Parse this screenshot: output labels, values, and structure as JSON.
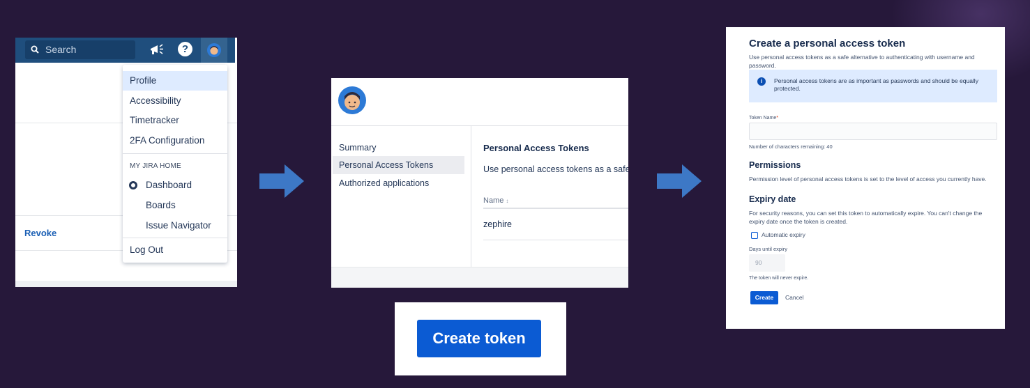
{
  "colors": {
    "background": "#26183a",
    "jira_header": "#1f4e7d",
    "primary_button": "#0b5bd3",
    "arrow": "#3d78c6"
  },
  "panel1": {
    "search": {
      "placeholder": "Search",
      "icon": "search-icon"
    },
    "header_icons": [
      "megaphone-icon",
      "help-icon",
      "avatar"
    ],
    "revoke_label": "Revoke",
    "menu": {
      "items_top": [
        "Profile",
        "Accessibility",
        "Timetracker",
        "2FA Configuration"
      ],
      "section_heading": "MY JIRA HOME",
      "home_options": [
        "Dashboard",
        "Boards",
        "Issue Navigator"
      ],
      "selected_home": "Dashboard",
      "logout": "Log Out"
    }
  },
  "panel2": {
    "nav": [
      "Summary",
      "Personal Access Tokens",
      "Authorized applications"
    ],
    "active_nav": "Personal Access Tokens",
    "section_title": "Personal Access Tokens",
    "description": "Use personal access tokens as a safe al",
    "table": {
      "header": "Name",
      "sort_indicator": "↕",
      "rows": [
        "zephire"
      ]
    }
  },
  "create_token_label": "Create token",
  "panel3": {
    "title": "Create a personal access token",
    "intro_line1": "Use personal access tokens as a safe alternative to authenticating with username and",
    "intro_line2": "password.",
    "info_message": "Personal access tokens are as important as passwords and should be equally protected.",
    "token_name_label": "Token Name",
    "required_marker": "*",
    "chars_remaining": "Number of characters remaining: 40",
    "permissions_heading": "Permissions",
    "permissions_text": "Permission level of personal access tokens is set to the level of access you currently have.",
    "expiry_heading": "Expiry date",
    "expiry_line1": "For security reasons, you can set this token to automatically expire. You can't change the",
    "expiry_line2": "expiry date once the token is created.",
    "automatic_expiry_label": "Automatic expiry",
    "automatic_expiry_checked": false,
    "days_label": "Days until expiry",
    "days_value": "90",
    "never_expire_note": "The token will never expire.",
    "create_button": "Create",
    "cancel_button": "Cancel"
  }
}
